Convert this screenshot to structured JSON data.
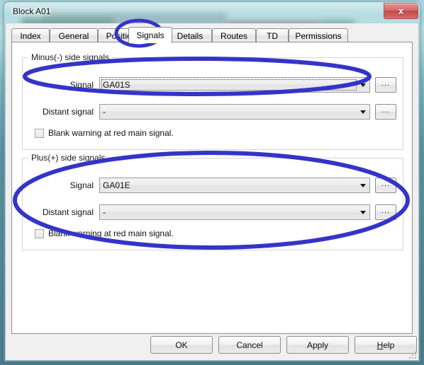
{
  "window": {
    "title": "Block A01",
    "close_label": "x",
    "close_icon": "close-icon"
  },
  "tabs": [
    {
      "label": "Index",
      "selected": false
    },
    {
      "label": "General",
      "selected": false
    },
    {
      "label": "Position",
      "selected": false
    },
    {
      "label": "Signals",
      "selected": true
    },
    {
      "label": "Details",
      "selected": false
    },
    {
      "label": "Routes",
      "selected": false
    },
    {
      "label": "TD",
      "selected": false
    },
    {
      "label": "Permissions",
      "selected": false
    }
  ],
  "groups": {
    "minus": {
      "legend": "Minus(-) side signals",
      "signal": {
        "label": "Signal",
        "value": "GA01S",
        "browse_label": "...",
        "focused": true
      },
      "distant": {
        "label": "Distant signal",
        "value": "-",
        "browse_label": "...",
        "focused": false
      },
      "checkbox": {
        "label": "Blank warning at red main signal.",
        "checked": false
      }
    },
    "plus": {
      "legend": "Plus(+) side signals",
      "signal": {
        "label": "Signal",
        "value": "GA01E",
        "browse_label": "...",
        "focused": false
      },
      "distant": {
        "label": "Distant signal",
        "value": "-",
        "browse_label": "...",
        "focused": false
      },
      "checkbox": {
        "label": "Blank warning at red main signal.",
        "checked": false
      }
    }
  },
  "buttons": {
    "ok": "OK",
    "cancel": "Cancel",
    "apply": "Apply",
    "help_prefix": "H",
    "help_rest": "elp"
  },
  "annotations": {
    "color": "#3434c8",
    "shapes": [
      {
        "name": "signals-tab-highlight"
      },
      {
        "name": "minus-signal-row-highlight"
      },
      {
        "name": "plus-side-block-highlight"
      }
    ]
  }
}
